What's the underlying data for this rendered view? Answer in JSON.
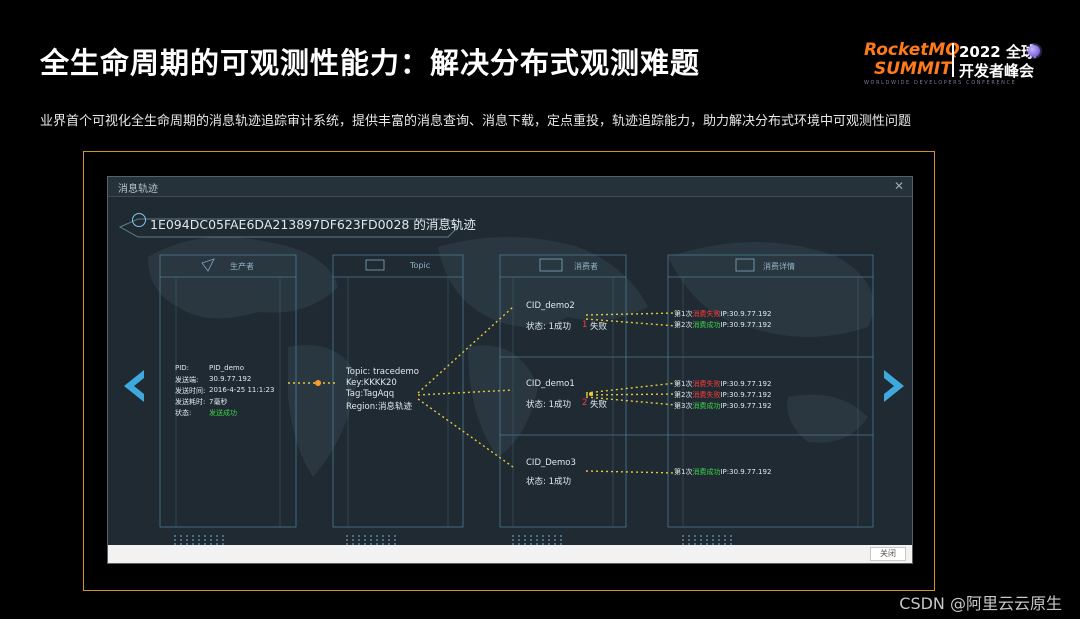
{
  "slide": {
    "title": "全生命周期的可观测性能力：解决分布式观测难题",
    "subtitle": "业界首个可视化全生命周期的消息轨迹追踪审计系统，提供丰富的消息查询、消息下载，定点重投，轨迹追踪能力，助力解决分布式环境中可观测性问题"
  },
  "brand": {
    "name_line1": "RocketMQ",
    "name_line2": "SUMMIT",
    "year": "2022 全球",
    "event": "开发者峰会",
    "tagline": "WORLDWIDE DEVELOPERS CONFERENCE",
    "accent": "#ff7a1a"
  },
  "panel": {
    "title": "消息轨迹",
    "trace_header": "1E094DC05FAE6DA213897DF623FD0028 的消息轨迹",
    "close_label": "关闭",
    "columns": [
      "生产者",
      "Topic",
      "消费者",
      "消费详情"
    ]
  },
  "producer": {
    "pid_label": "PID:",
    "pid_value": "PID_demo",
    "host_label": "发送端:",
    "host_value": "30.9.77.192",
    "time_label": "发送时间:",
    "time_value": "2016-4-25 11:1:23",
    "cost_label": "发送耗时:",
    "cost_value": "7毫秒",
    "status_label": "状态:",
    "status_value": "发送成功"
  },
  "topic": {
    "topic": "Topic: tracedemo",
    "key": "Key:KKKK20",
    "tag": "Tag:TagAqq",
    "region": "Region:消息轨迹"
  },
  "consumers": [
    {
      "name": "CID_demo2",
      "status_prefix": "状态: 1成功",
      "fail_count": "1",
      "status_suffix": "失败",
      "details": [
        {
          "prefix": "第1次",
          "result": "消费失败",
          "ip": "IP:30.9.77.192",
          "ok": false
        },
        {
          "prefix": "第2次",
          "result": "消费成功",
          "ip": "IP:30.9.77.192",
          "ok": true
        }
      ]
    },
    {
      "name": "CID_demo1",
      "status_prefix": "状态: 1成功",
      "fail_count": "2",
      "status_suffix": "失败",
      "details": [
        {
          "prefix": "第1次",
          "result": "消费失败",
          "ip": "IP:30.9.77.192",
          "ok": false
        },
        {
          "prefix": "第2次",
          "result": "消费失败",
          "ip": "IP:30.9.77.192",
          "ok": false
        },
        {
          "prefix": "第3次",
          "result": "消费成功",
          "ip": "IP:30.9.77.192",
          "ok": true
        }
      ]
    },
    {
      "name": "CID_Demo3",
      "status_prefix": "状态: 1成功",
      "fail_count": "",
      "status_suffix": "",
      "details": [
        {
          "prefix": "第1次",
          "result": "消费成功",
          "ip": "IP:30.9.77.192",
          "ok": true
        }
      ]
    }
  ],
  "watermark": "CSDN @阿里云云原生",
  "colors": {
    "frame_border": "#d4932a",
    "arrow": "#3fa9de",
    "fail": "#ff3b3b",
    "success": "#3fd24a",
    "dotted_link": "#e8c93a"
  }
}
